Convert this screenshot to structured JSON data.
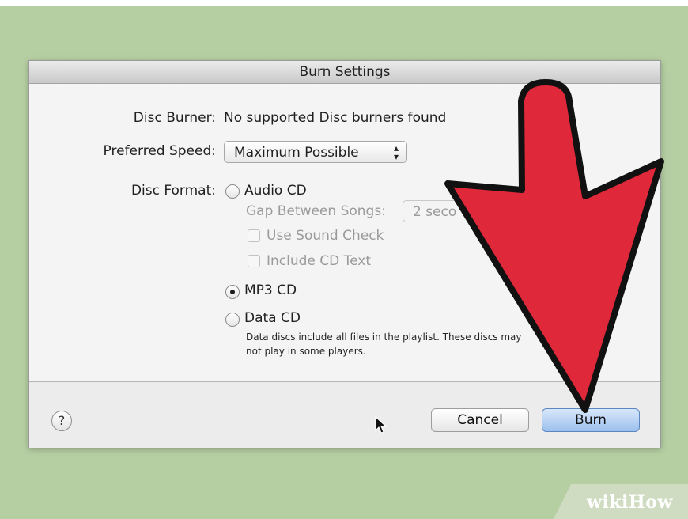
{
  "dialog": {
    "title": "Burn Settings",
    "disc_burner_label": "Disc Burner:",
    "disc_burner_value": "No supported Disc burners found",
    "preferred_speed_label": "Preferred Speed:",
    "preferred_speed_value": "Maximum Possible",
    "disc_format_label": "Disc Format:",
    "options": {
      "audio_cd": "Audio CD",
      "gap_label": "Gap Between Songs:",
      "gap_value": "2 seco",
      "sound_check": "Use Sound Check",
      "cd_text": "Include CD Text",
      "mp3_cd": "MP3 CD",
      "data_cd": "Data CD",
      "data_note": "Data discs include all files in the playlist.  These discs may not play in some players."
    },
    "selected_format": "MP3 CD",
    "help_symbol": "?",
    "cancel_label": "Cancel",
    "burn_label": "Burn"
  },
  "overlay": {
    "arrow_color": "#e0283b",
    "watermark": "wikiHow",
    "watermark_wiki": "wiki",
    "watermark_how": "How"
  },
  "icons": {
    "help": "question-mark-icon",
    "cursor": "mouse-pointer-icon",
    "popup_arrows": "up-down-chevron-icon"
  }
}
